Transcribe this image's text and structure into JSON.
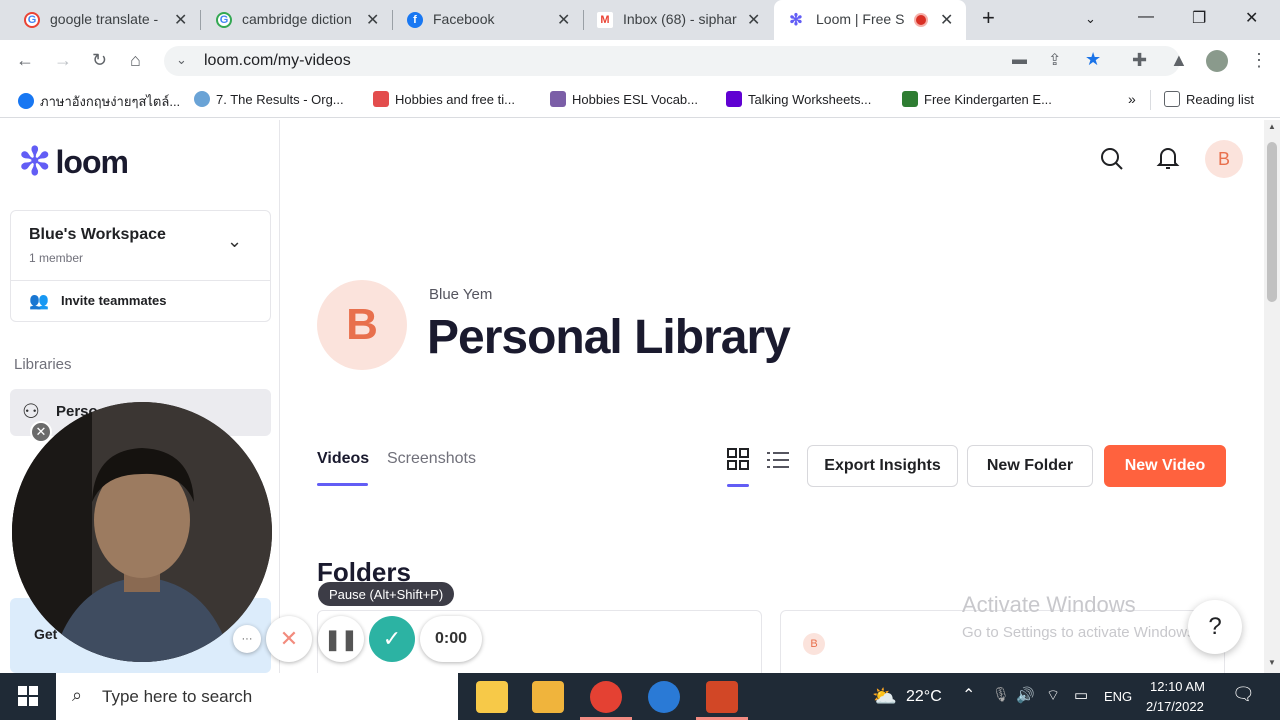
{
  "browser": {
    "tabs": [
      {
        "title": "google translate -",
        "favicon": "google-icon"
      },
      {
        "title": "cambridge diction",
        "favicon": "google-icon"
      },
      {
        "title": "Facebook",
        "favicon": "facebook-icon"
      },
      {
        "title": "Inbox (68) - siphar",
        "favicon": "gmail-icon"
      },
      {
        "title": "Loom | Free Sc",
        "favicon": "loom-icon",
        "active": true
      }
    ],
    "url": "loom.com/my-videos",
    "bookmarks": [
      "ภาษาอังกฤษง่ายๆสไตล์...",
      "7. The Results - Org...",
      "Hobbies and free ti...",
      "Hobbies ESL Vocab...",
      "Talking Worksheets...",
      "Free Kindergarten E..."
    ],
    "reading_list": "Reading list"
  },
  "sidebar": {
    "logo": "loom",
    "workspace_name": "Blue's Workspace",
    "workspace_members": "1 member",
    "invite": "Invite teammates",
    "libraries_label": "Libraries",
    "library_item": "Perso",
    "get_label": "Get"
  },
  "header": {
    "avatar_letter": "B"
  },
  "library": {
    "owner": "Blue Yem",
    "title": "Personal Library",
    "avatar_letter": "B",
    "tabs": [
      "Videos",
      "Screenshots"
    ],
    "buttons": {
      "export": "Export Insights",
      "new_folder": "New Folder",
      "new_video": "New Video"
    },
    "folders_heading": "Folders",
    "card_avatar": "B"
  },
  "recorder": {
    "tooltip": "Pause (Alt+Shift+P)",
    "timer": "0:00",
    "more": "···"
  },
  "watermark": {
    "line1": "Activate Windows",
    "line2": "Go to Settings to activate Windows."
  },
  "help": "?",
  "taskbar": {
    "search_placeholder": "Type here to search",
    "temp": "22°C",
    "lang": "ENG",
    "time": "12:10 AM",
    "date": "2/17/2022"
  },
  "colors": {
    "accent": "#625df5",
    "new_video": "#ff623e",
    "avatar_bg": "#fbe3dc",
    "avatar_fg": "#e8704d",
    "check": "#2cb3a3"
  }
}
